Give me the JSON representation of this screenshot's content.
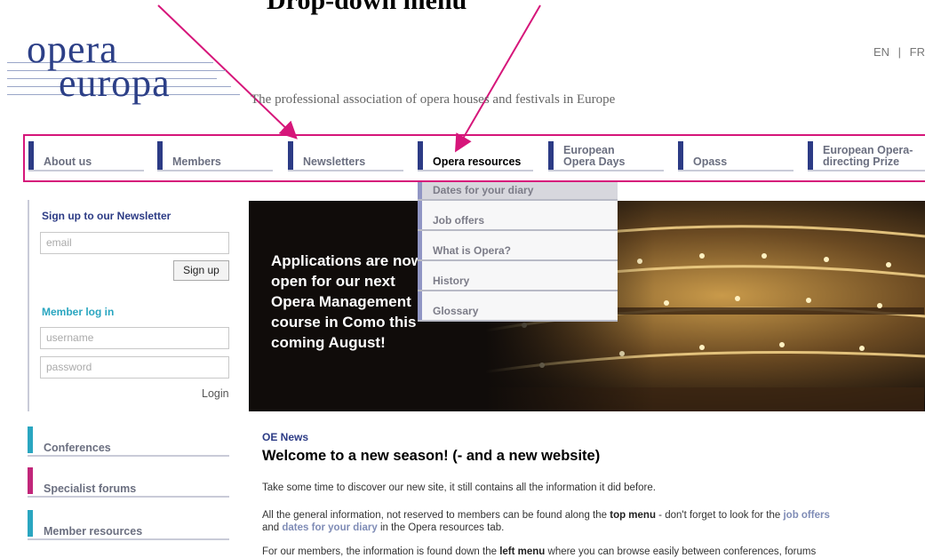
{
  "annotation": {
    "text": "Drop-down menu"
  },
  "logo": {
    "line1": "opera",
    "line2": "europa"
  },
  "tagline": "The professional association of opera houses and festivals in Europe",
  "lang": {
    "en": "EN",
    "sep": "|",
    "fr": "FR"
  },
  "nav": [
    {
      "label": "About us"
    },
    {
      "label": "Members"
    },
    {
      "label": "Newsletters"
    },
    {
      "label": "Opera resources"
    },
    {
      "label": "European\nOpera Days"
    },
    {
      "label": "Opass"
    },
    {
      "label": "European Opera-\ndirecting Prize"
    }
  ],
  "dropdown": [
    {
      "label": "Dates for your diary"
    },
    {
      "label": "Job offers"
    },
    {
      "label": "What is Opera?"
    },
    {
      "label": "History"
    },
    {
      "label": "Glossary"
    }
  ],
  "sidebar": {
    "newsletter_title": "Sign up to our Newsletter",
    "email_placeholder": "email",
    "signup_label": "Sign up",
    "member_title": "Member log in",
    "username_placeholder": "username",
    "password_placeholder": "password",
    "login_label": "Login",
    "nav": [
      {
        "label": "Conferences",
        "color": "#2aa6c0"
      },
      {
        "label": "Specialist forums",
        "color": "#c1267a"
      },
      {
        "label": "Member resources",
        "color": "#2aa6c0"
      }
    ]
  },
  "banner": {
    "line1": "Applications are now",
    "line2": "open for our next",
    "line3": "Opera Management",
    "line4": "course in Como this",
    "line5": "coming August!"
  },
  "news": {
    "label": "OE News",
    "title": "Welcome to a new season! (- and a new website)",
    "p1": "Take some time to discover our new site, it still contains all the information it did before.",
    "p2_a": "All the general information, not reserved to members can be found along the ",
    "p2_b": "top menu",
    "p2_c": " - don't forget to look for the ",
    "p2_d": "job offers",
    "p2_e": "and ",
    "p2_f": "dates for your diary",
    "p2_g": " in the Opera resources tab.",
    "p3_a": "For our members, the information is found down the ",
    "p3_b": "left menu",
    "p3_c": " where you can browse easily between conferences, forums"
  },
  "colors": {
    "accent_navy": "#2c3b85",
    "annotation_pink": "#d6167a",
    "teal": "#2aa6c0",
    "magenta": "#c1267a"
  }
}
